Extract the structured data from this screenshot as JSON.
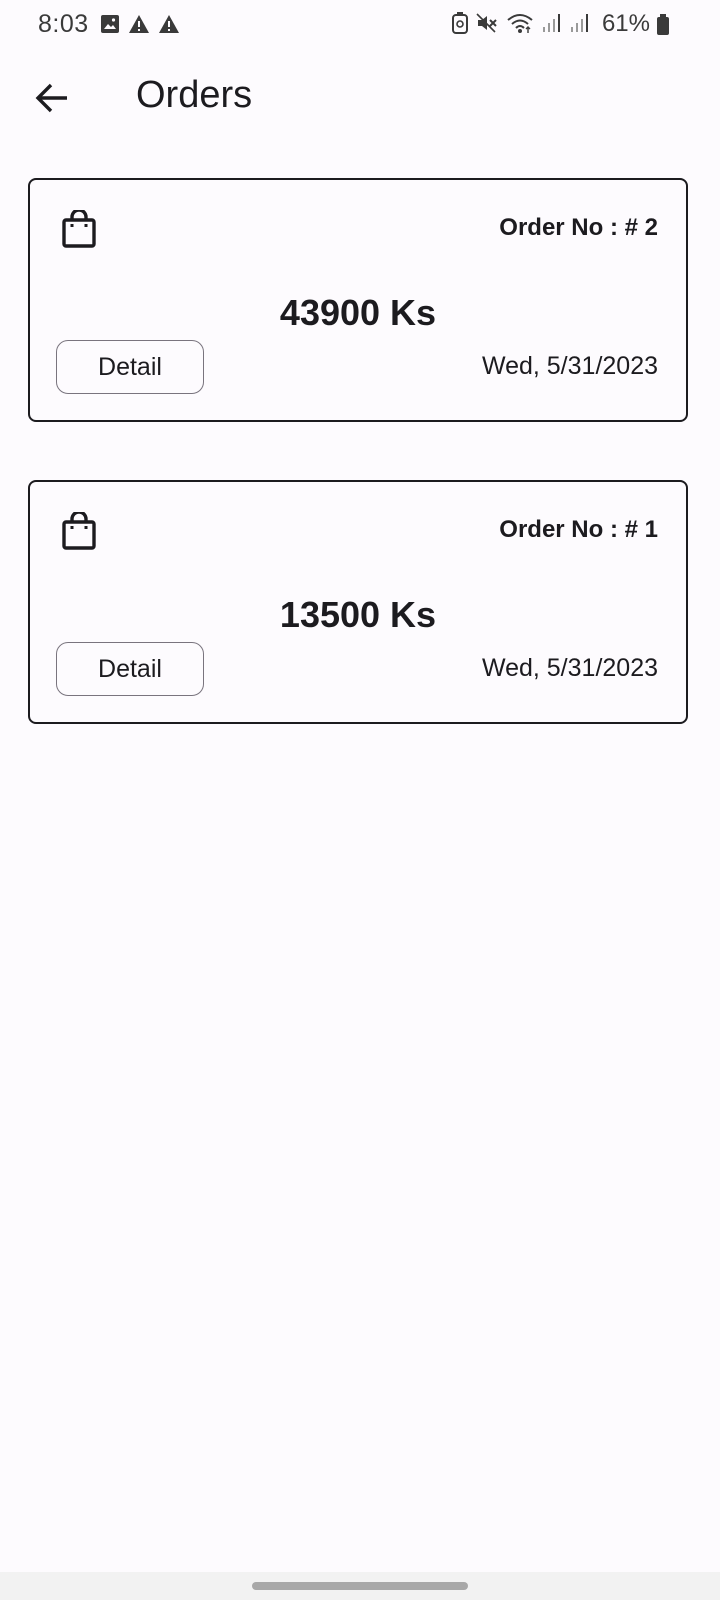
{
  "status_bar": {
    "time": "8:03",
    "battery_text": "61%",
    "left_icons": [
      "image-icon",
      "warning-icon",
      "warning-icon"
    ],
    "right_icons": [
      "battery-saver-icon",
      "mute-icon",
      "wifi-icon",
      "signal-icon",
      "signal-icon",
      "battery-icon"
    ]
  },
  "app_bar": {
    "title": "Orders",
    "back_icon": "arrow-back-icon"
  },
  "orders": [
    {
      "order_no": "Order No : # 2",
      "amount": "43900 Ks",
      "detail_label": "Detail",
      "date": "Wed, 5/31/2023"
    },
    {
      "order_no": "Order No : # 1",
      "amount": "13500 Ks",
      "detail_label": "Detail",
      "date": "Wed, 5/31/2023"
    }
  ],
  "colors": {
    "background": "#fdfbfe",
    "text": "#1c1b1f",
    "outline": "#79747e"
  }
}
